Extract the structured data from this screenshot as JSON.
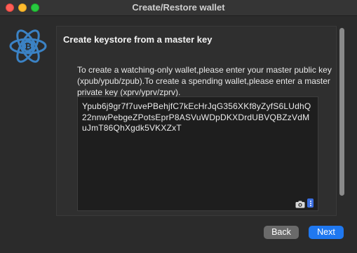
{
  "window": {
    "title": "Create/Restore wallet"
  },
  "logo": {
    "icon": "bitcoin-atom-logo-icon",
    "color": "#3b82c4"
  },
  "page": {
    "heading": "Create keystore from a master key",
    "instructions": "To create a watching-only wallet,please enter your master public key (xpub/ypub/zpub).To create a spending wallet,please enter a master private key (xprv/yprv/zprv).",
    "key_value": "Ypub6j9gr7f7uvePBehjfC7kEcHrJqG356XKf8yZyfS6LUdhQ22nnwPebgeZPotsEprP8ASVuWDpDKXDrdUBVQBZzVdMuJmT86QhXgdk5VKXZxT"
  },
  "buttons": {
    "back": "Back",
    "next": "Next"
  },
  "colors": {
    "accent": "#1f78f0",
    "background": "#2b2b2b"
  }
}
